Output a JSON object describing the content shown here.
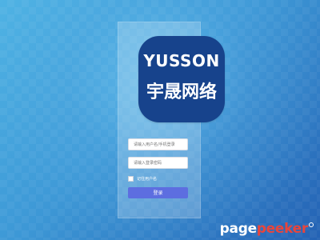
{
  "logo": {
    "text_en": "YUSSON",
    "text_cn": "宇晟网络",
    "background": "#17438c"
  },
  "form": {
    "username_placeholder": "请输入用户名/手机登录",
    "password_placeholder": "请输入登录密码",
    "remember_label": "记住用户名",
    "remember_checked": false,
    "submit_label": "登录",
    "submit_color": "#5d6ee0"
  },
  "watermark": {
    "part1": "page",
    "part2": "peeker",
    "accent": "#e8453c"
  }
}
